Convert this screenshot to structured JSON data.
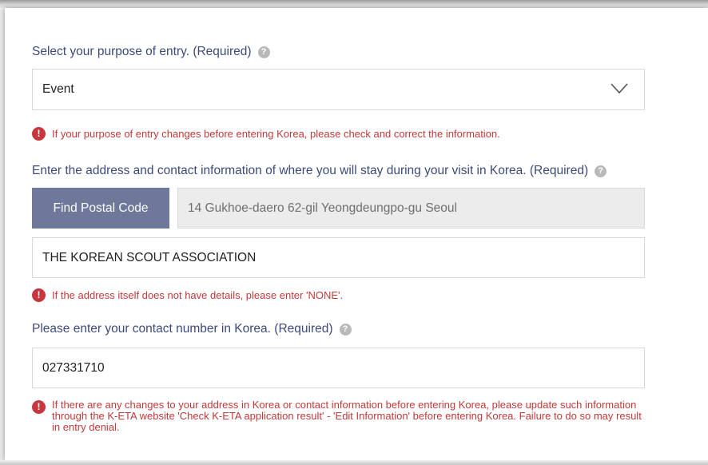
{
  "purpose": {
    "label": "Select your purpose of entry. (Required)",
    "selected_value": "Event",
    "warning": "If your purpose of entry changes before entering Korea, please check and correct the information."
  },
  "address": {
    "label": "Enter the address and contact information of where you will stay during your visit in Korea. (Required)",
    "find_postal_button": "Find Postal Code",
    "address_value": "14 Gukhoe-daero 62-gil Yeongdeungpo-gu Seoul",
    "detail_value": "THE KOREAN SCOUT ASSOCIATION",
    "warning": "If the address itself does not have details, please enter 'NONE'."
  },
  "contact": {
    "label": "Please enter your contact number in Korea. (Required)",
    "phone_value": "027331710",
    "warning": "If there are any changes to your address in Korea or contact information before entering Korea, please update such information through the K-ETA website 'Check K-ETA application result' - 'Edit Information' before entering Korea. Failure to do so may result in entry denial."
  },
  "icons": {
    "help_glyph": "?",
    "warning_glyph": "!"
  },
  "colors": {
    "label": "#3d4b7a",
    "warning": "#c23a3a",
    "button": "#6d789a"
  }
}
